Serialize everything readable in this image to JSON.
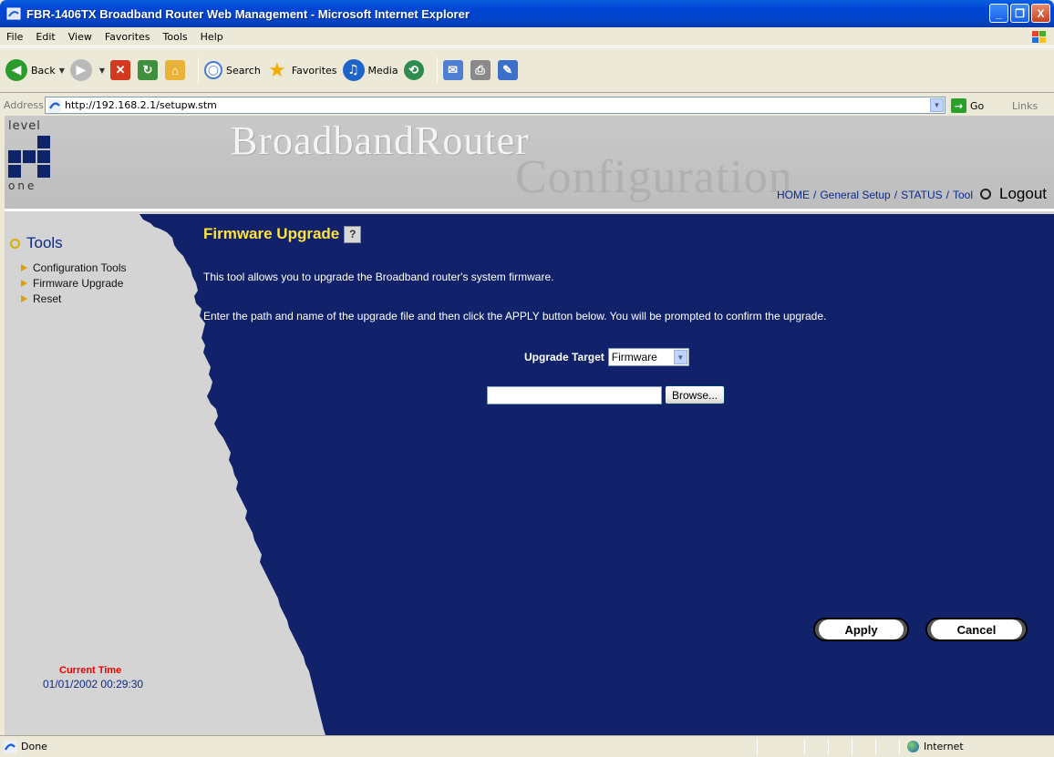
{
  "window": {
    "title": "FBR-1406TX Broadband Router Web Management - Microsoft Internet Explorer",
    "minimize_label": "_",
    "maximize_label": "❐",
    "close_label": "X"
  },
  "menu": {
    "items": [
      {
        "label": "File"
      },
      {
        "label": "Edit"
      },
      {
        "label": "View"
      },
      {
        "label": "Favorites"
      },
      {
        "label": "Tools"
      },
      {
        "label": "Help"
      }
    ]
  },
  "toolbar": {
    "back_label": "Back",
    "search_label": "Search",
    "favorites_label": "Favorites",
    "media_label": "Media"
  },
  "address": {
    "label": "Address",
    "url": "http://192.168.2.1/setupw.stm",
    "go_label": "Go",
    "links_label": "Links"
  },
  "router_header": {
    "logo_top": "level",
    "logo_bottom": "one",
    "banner_main": "BroadbandRouter",
    "banner_sub": "Configuration",
    "nav": {
      "home": "HOME",
      "general_setup": "General Setup",
      "status": "STATUS",
      "tool": "Tool",
      "logout": "Logout",
      "separator": "/"
    }
  },
  "sidebar": {
    "title": "Tools",
    "items": [
      {
        "label": "Configuration Tools"
      },
      {
        "label": "Firmware Upgrade"
      },
      {
        "label": "Reset"
      }
    ],
    "current_time_label": "Current Time",
    "current_time_value": "01/01/2002 00:29:30"
  },
  "main": {
    "title": "Firmware Upgrade",
    "help_icon": "?",
    "description1": "This tool allows you to upgrade the Broadband router's system firmware.",
    "description2": "Enter the path and name of the upgrade file and then click the APPLY button below. You will be prompted to confirm the upgrade.",
    "upgrade_target_label": "Upgrade Target",
    "upgrade_target_value": "Firmware",
    "file_path_value": "",
    "browse_label": "Browse...",
    "apply_label": "Apply",
    "cancel_label": "Cancel"
  },
  "statusbar": {
    "status_text": "Done",
    "zone_text": "Internet"
  },
  "colors": {
    "panel_blue": "#11226b",
    "title_yellow": "#ffe33a",
    "nav_blue": "#0a2a8c",
    "time_label_red": "#ee0000"
  }
}
